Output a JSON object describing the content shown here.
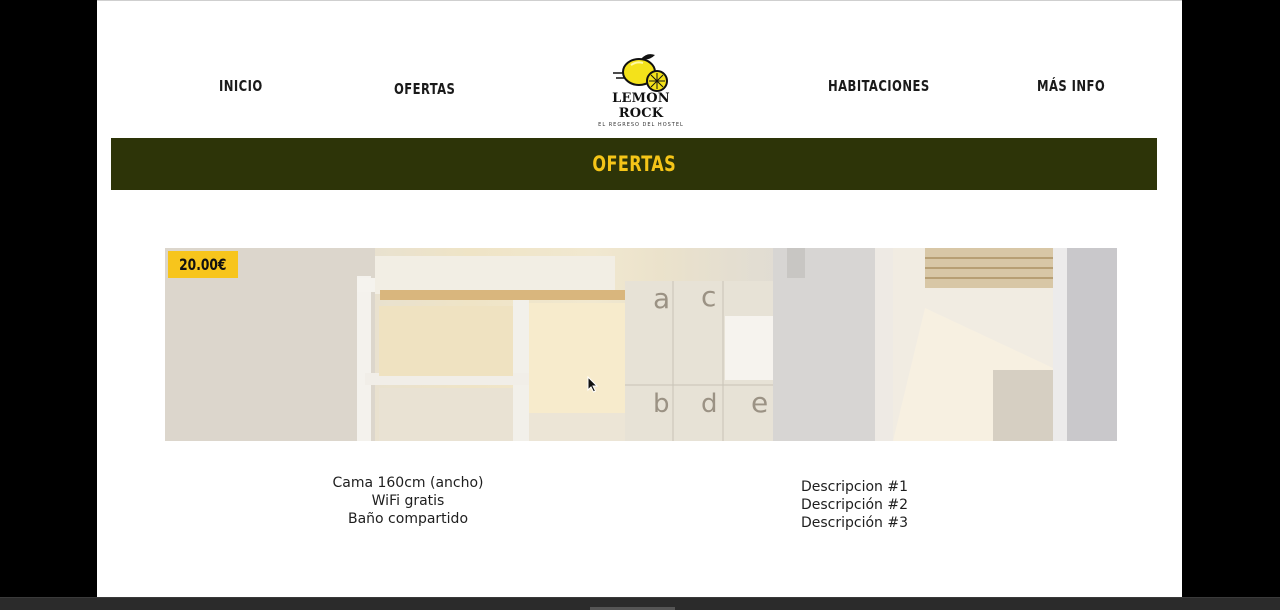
{
  "nav": {
    "inicio": "INICIO",
    "ofertas": "OFERTAS",
    "habitaciones": "HABITACIONES",
    "mas_info": "MÁS INFO"
  },
  "logo": {
    "name": "LEMON ROCK",
    "tagline": "EL REGRESO DEL HOSTEL",
    "icon": "lemon-icon"
  },
  "banner": {
    "title": "OFERTAS"
  },
  "offer": {
    "price": "20.00€",
    "image": "bunk-bed-room-photo",
    "features_left": [
      "Cama 160cm (ancho)",
      "WiFi gratis",
      "Baño compartido"
    ],
    "features_right": [
      "Descripcion #1",
      "Descripción #2",
      "Descripción #3"
    ]
  },
  "colors": {
    "banner_bg": "#2d3408",
    "accent_yellow": "#f5c518",
    "price_bg": "#f7c51c"
  }
}
